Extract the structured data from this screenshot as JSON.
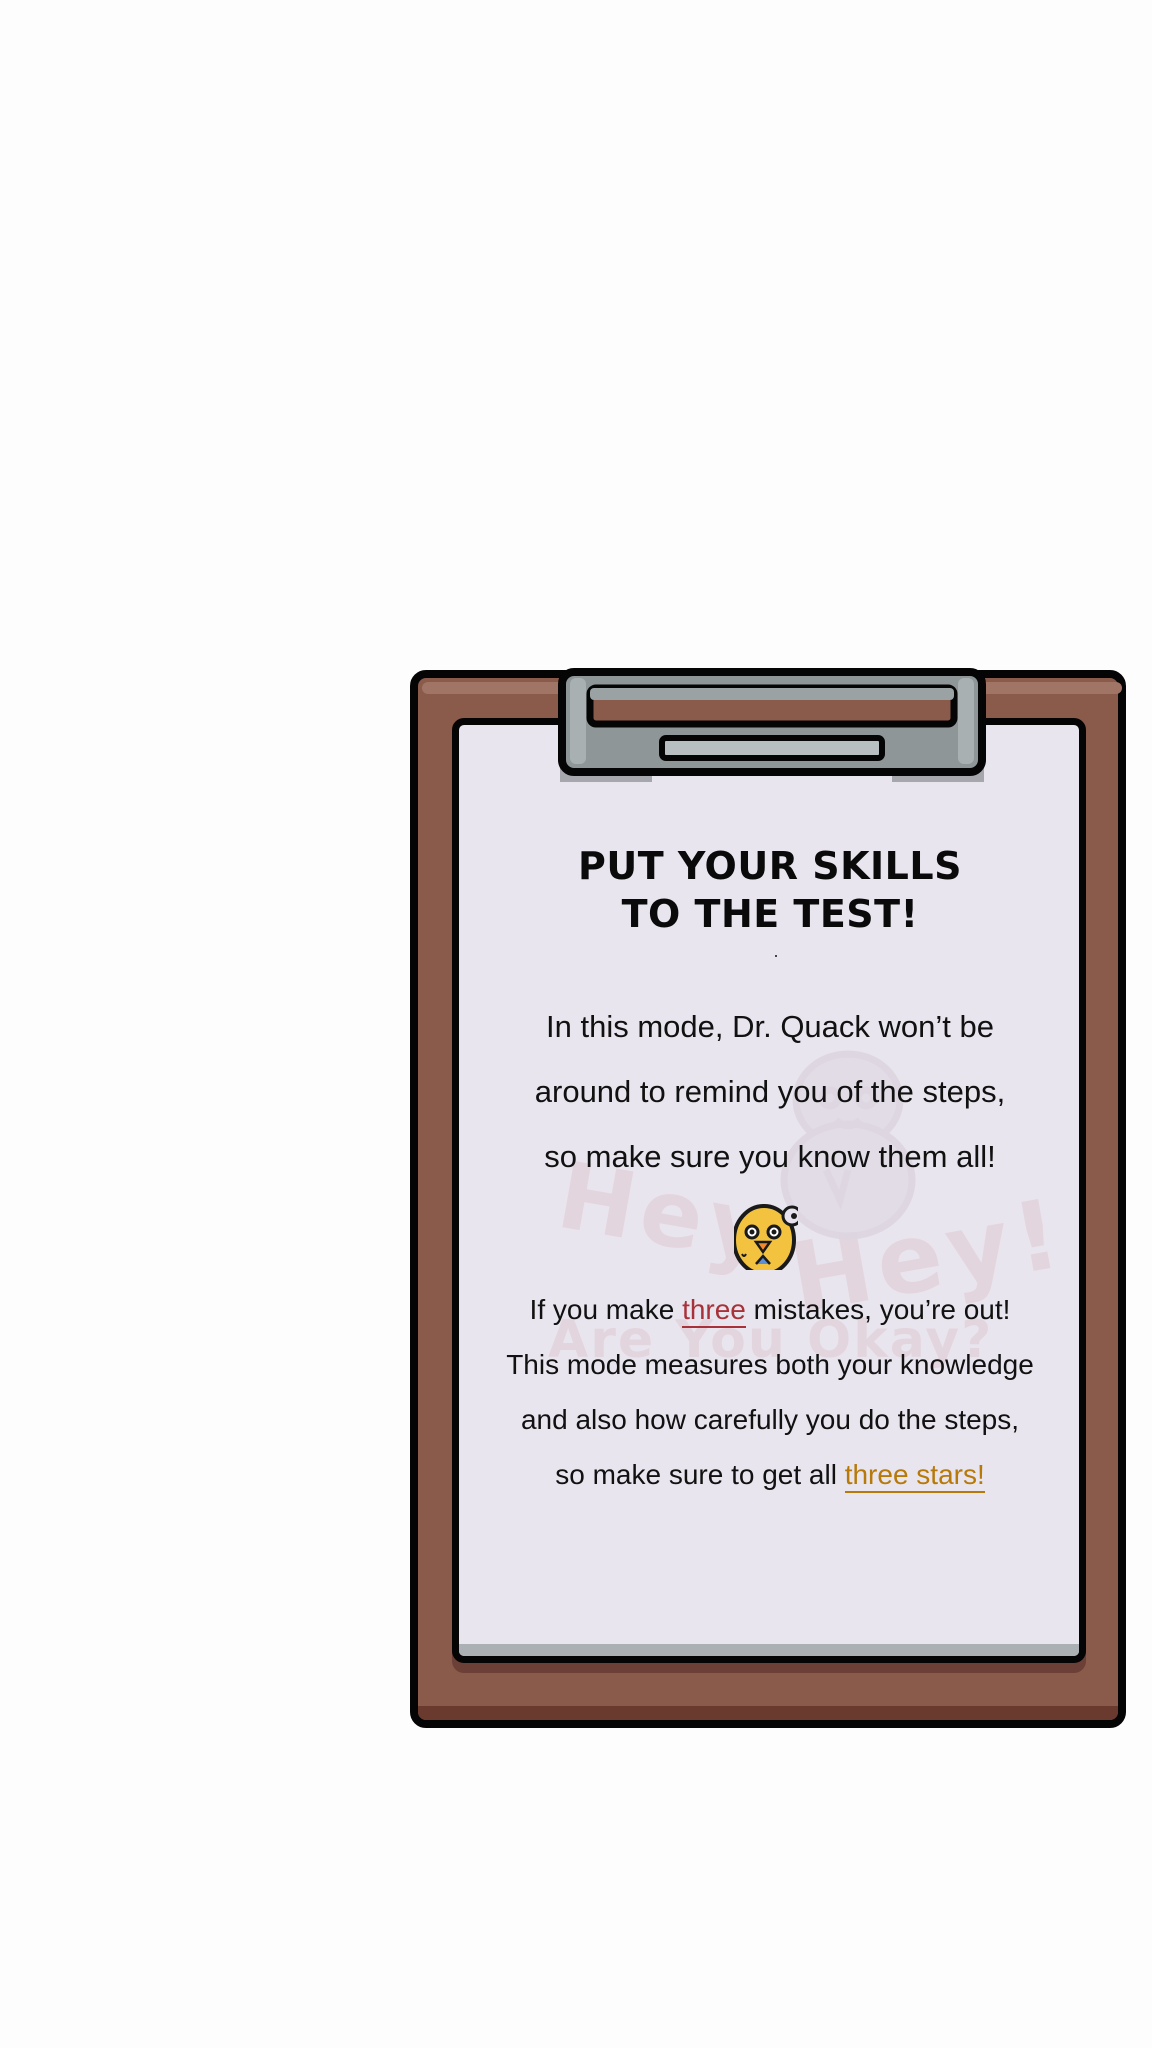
{
  "card": {
    "title_line1": "PUT YOUR SKILLS",
    "title_line2": "TO THE TEST!",
    "intro_lines": [
      "In this mode, Dr. Quack won’t be",
      "around to remind you of the steps,",
      "so make sure you know them all!"
    ],
    "rules": {
      "line1_before": "If you make ",
      "line1_highlight": "three",
      "line1_after": " mistakes, you’re out!",
      "line2": "This mode measures both your knowledge",
      "line3": "and also how carefully you do the steps,",
      "line4_before": "so make sure to get all ",
      "line4_highlight": "three stars!"
    },
    "watermark": {
      "word1": "Hey",
      "word2": "Hey!",
      "line3": "Are You Okay?"
    }
  },
  "colors": {
    "board": "#8a5a4a",
    "paper": "#e8e5ee",
    "clip": "#8e9698",
    "highlight_red": "#a8323a",
    "highlight_gold": "#b77908"
  },
  "icons": [
    "clipboard-clip-icon",
    "duck-mascot-icon",
    "ghost-duck-icon"
  ]
}
